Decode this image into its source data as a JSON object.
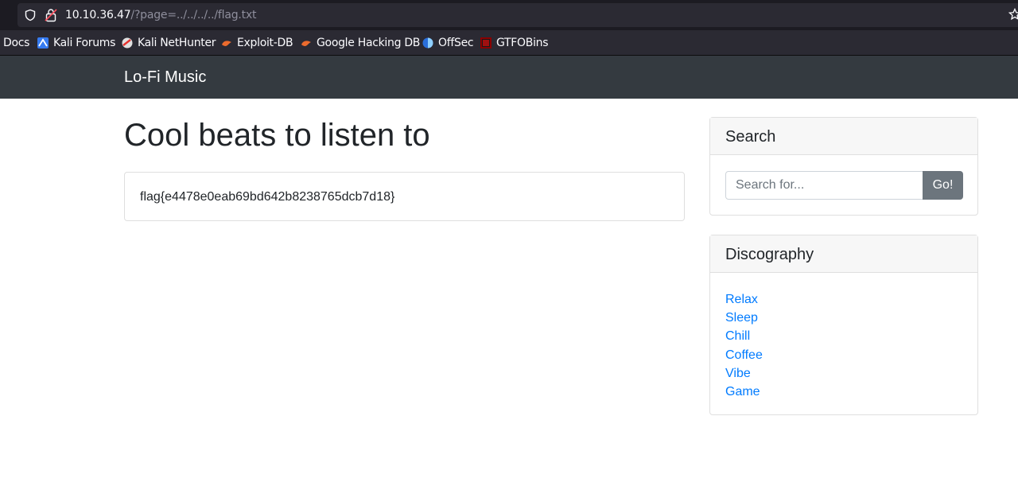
{
  "browser": {
    "url_host": "10.10.36.47",
    "url_path": "/?page=../../../../flag.txt",
    "bookmarks": [
      {
        "label": "Docs",
        "icon": "none"
      },
      {
        "label": "Kali Forums",
        "icon": "kali-dragon-icon"
      },
      {
        "label": "Kali NetHunter",
        "icon": "nethunter-icon"
      },
      {
        "label": "Exploit-DB",
        "icon": "exploitdb-icon"
      },
      {
        "label": "Google Hacking DB",
        "icon": "exploitdb-icon"
      },
      {
        "label": "OffSec",
        "icon": "offsec-icon"
      },
      {
        "label": "GTFOBins",
        "icon": "gtfobins-icon"
      }
    ]
  },
  "navbar": {
    "brand": "Lo-Fi Music"
  },
  "main": {
    "title": "Cool beats to listen to",
    "content": "flag{e4478e0eab69bd642b8238765dcb7d18}"
  },
  "search": {
    "header": "Search",
    "placeholder": "Search for...",
    "button": "Go!"
  },
  "discography": {
    "header": "Discography",
    "items": [
      "Relax",
      "Sleep",
      "Chill",
      "Coffee",
      "Vibe",
      "Game"
    ]
  },
  "colors": {
    "navbar_bg": "#343a40",
    "link": "#007bff",
    "button_bg": "#6c757d"
  }
}
